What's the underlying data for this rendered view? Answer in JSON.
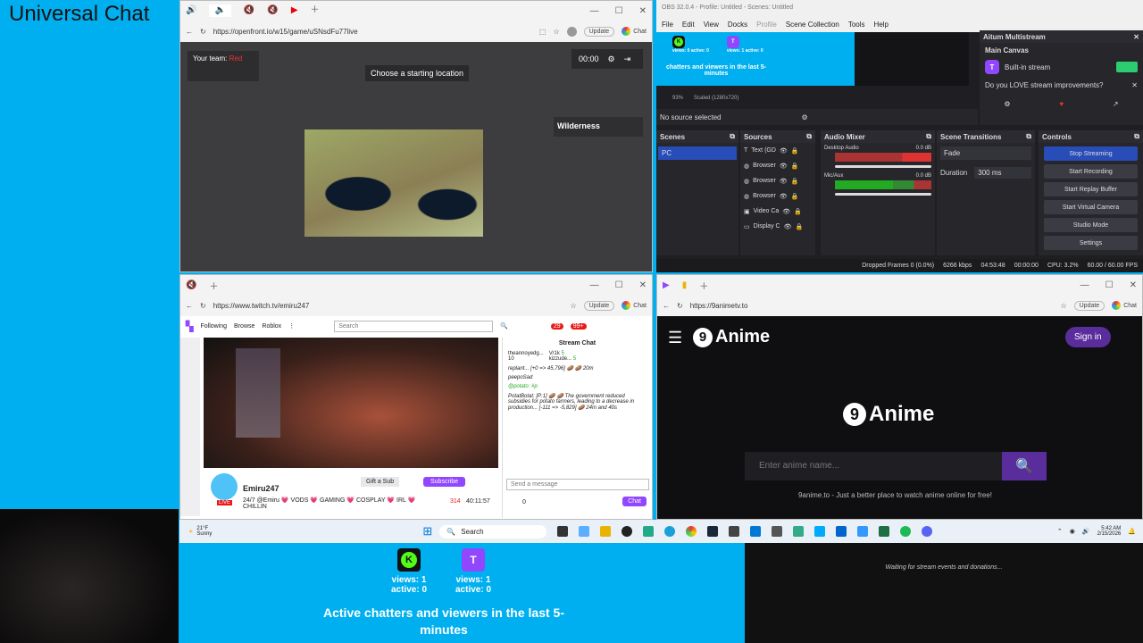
{
  "overlay": {
    "title": "Universal Chat"
  },
  "game_browser": {
    "url": "https://openfront.io/w15/game/uSNsdFu77live",
    "update_label": "Update",
    "chat_label": "Chat",
    "team_label": "Your team:",
    "team_value": "Red",
    "prompt": "Choose a starting location",
    "timer": "00:00",
    "region": "Wilderness"
  },
  "obs": {
    "title": "OBS 32.0.4 - Profile: Untitled - Scenes: Untitled",
    "menu": [
      "File",
      "Edit",
      "View",
      "Docks",
      "Profile",
      "Scene Collection",
      "Tools",
      "Help"
    ],
    "preview_text": "chatters and viewers in the last 5-minutes",
    "preview_kick": "views: 0 active: 0",
    "preview_twitch": "views: 1 active: 0",
    "zoom": "93%",
    "scale": "Scaled (1280x720)",
    "no_source": "No source selected",
    "aitum": {
      "title": "Aitum Multistream",
      "canvas": "Main Canvas",
      "stream": "Built-in stream",
      "promo": "Do you LOVE stream improvements?"
    },
    "scenes": {
      "title": "Scenes",
      "items": [
        "PC"
      ]
    },
    "sources": {
      "title": "Sources",
      "items": [
        "Text (GD",
        "Browser",
        "Browser",
        "Browser",
        "Video Ca",
        "Display C"
      ]
    },
    "mixer": {
      "title": "Audio Mixer",
      "channels": [
        {
          "name": "Desktop Audio",
          "db": "0.0 dB"
        },
        {
          "name": "Mic/Aux",
          "db": "0.0 dB"
        }
      ]
    },
    "transitions": {
      "title": "Scene Transitions",
      "type": "Fade",
      "duration_label": "Duration",
      "duration": "300 ms"
    },
    "controls": {
      "title": "Controls",
      "buttons": [
        "Stop Streaming",
        "Start Recording",
        "Start Replay Buffer",
        "Start Virtual Camera",
        "Studio Mode",
        "Settings"
      ]
    },
    "status": {
      "dropped": "Dropped Frames 0 (0.0%)",
      "bitrate": "6266 kbps",
      "live_time": "04:53:48",
      "rec_time": "00:00:00",
      "cpu": "CPU: 3.2%",
      "fps": "60.00 / 60.00 FPS"
    }
  },
  "twitch_browser": {
    "url": "https://www.twitch.tv/emiru247",
    "nav": [
      "Following",
      "Browse",
      "Roblox"
    ],
    "search_placeholder": "Search",
    "badge_notif": "29",
    "badge_gift": "99+",
    "streamer": "Emiru247",
    "follow_label": "Gift a Sub",
    "subscribe_label": "Subscribe",
    "stream_title": "24/7 @Emiru 💗 VODS 💗 GAMING 💗 COSPLAY 💗 IRL 💗 CHILLIN",
    "viewers": "314",
    "uptime": "40:11:57",
    "live_badge": "LIVE",
    "chat_title": "Stream Chat",
    "gifter1": "theannoyedg...",
    "gift_count": "10",
    "gifter2": "Vr1k",
    "gifter3": "kizzude...",
    "gifter2_count": "5",
    "gifter3_count": "5",
    "messages": [
      "replant... [+0 => 45,796] 🥔 🥔 20m",
      "peepoSad",
      "@potato: #p",
      "PotatBotat: [P:1] 🥔 🥔 The government reduced subsidies for potato farmers, leading to a decrease in production... [-111 => -5,829] 🥔 24m and 40s"
    ],
    "send_placeholder": "Send a message",
    "points": "0",
    "chat_button": "Chat"
  },
  "anime_browser": {
    "url": "https://9animetv.to",
    "logo_num": "9",
    "logo_text": "Anime",
    "login": "Sign in",
    "search_placeholder": "Enter anime name...",
    "tagline": "9anime.to - Just a better place to watch anime online for free!"
  },
  "taskbar": {
    "weather_temp": "21°F",
    "weather_desc": "Sunny",
    "search": "Search",
    "time": "5:42 AM",
    "date": "2/15/2026"
  },
  "stats": {
    "kick_views": "views: 1",
    "kick_active": "active: 0",
    "twitch_views": "views: 1",
    "twitch_active": "active: 0",
    "caption": "Active chatters and viewers in the last 5-minutes"
  },
  "events": {
    "waiting": "Waiting for stream events and donations..."
  },
  "colors": {
    "cyan": "#00aff0",
    "twitch": "#9146ff",
    "kick": "#53fc18",
    "obs_blue": "#284cb8",
    "anime_purple": "#5a2d9c"
  }
}
